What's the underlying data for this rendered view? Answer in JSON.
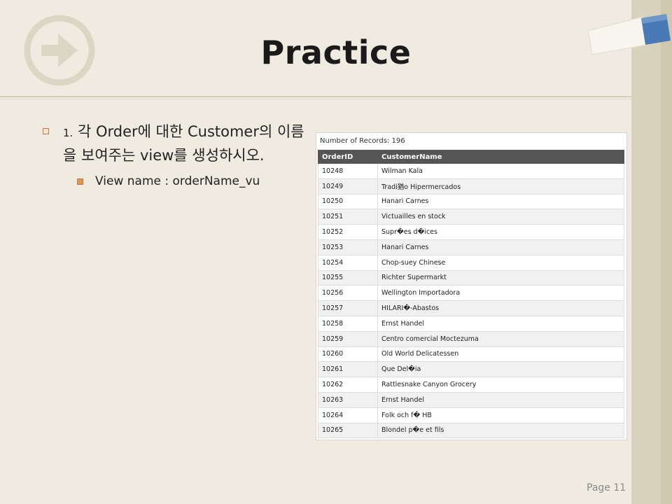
{
  "slide": {
    "title": "Practice",
    "bullet_1_number": "1.",
    "bullet_1_text": "각 Order에 대한 Customer의 이름을 보여주는 view를 생성하시오.",
    "bullet_2_text": "View name : orderName_vu",
    "page_label": "Page 11"
  },
  "result_panel": {
    "records_label": "Number of Records: 196",
    "columns": [
      "OrderID",
      "CustomerName"
    ],
    "rows": [
      [
        "10248",
        "Wilman Kala"
      ],
      [
        "10249",
        "Tradi猶o Hipermercados"
      ],
      [
        "10250",
        "Hanari Carnes"
      ],
      [
        "10251",
        "Victuailles en stock"
      ],
      [
        "10252",
        "Supr�es d�ices"
      ],
      [
        "10253",
        "Hanari Carnes"
      ],
      [
        "10254",
        "Chop-suey Chinese"
      ],
      [
        "10255",
        "Richter Supermarkt"
      ],
      [
        "10256",
        "Wellington Importadora"
      ],
      [
        "10257",
        "HILARI�-Abastos"
      ],
      [
        "10258",
        "Ernst Handel"
      ],
      [
        "10259",
        "Centro comercial Moctezuma"
      ],
      [
        "10260",
        "Old World Delicatessen"
      ],
      [
        "10261",
        "Que Del�ia"
      ],
      [
        "10262",
        "Rattlesnake Canyon Grocery"
      ],
      [
        "10263",
        "Ernst Handel"
      ],
      [
        "10264",
        "Folk och f� HB"
      ],
      [
        "10265",
        "Blondel p�e et fils"
      ]
    ]
  },
  "colors": {
    "background": "#efebe0",
    "accent_orange": "#c6793d",
    "accent_blue": "#4a7ab5",
    "header_gray": "#555555"
  },
  "icons": [
    "arrow-circle-logo",
    "blue-tab-decoration",
    "bullet-square-open",
    "bullet-square-filled"
  ]
}
